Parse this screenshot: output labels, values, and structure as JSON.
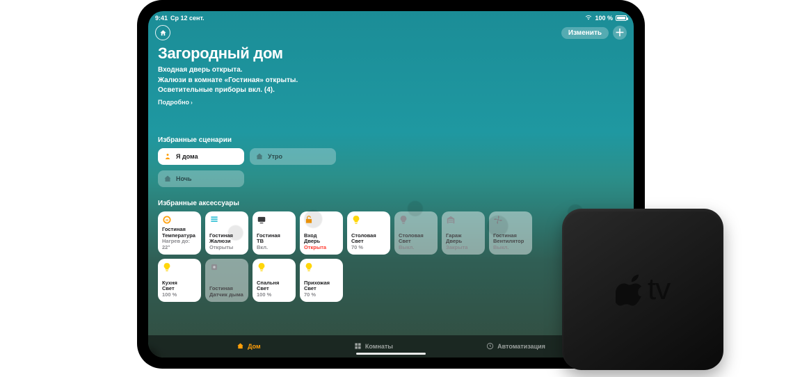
{
  "statusbar": {
    "time": "9:41",
    "date": "Ср 12 сент.",
    "battery_pct": "100 %"
  },
  "nav": {
    "edit_label": "Изменить"
  },
  "header": {
    "title": "Загородный дом",
    "lines": [
      "Входная дверь открыта.",
      "Жалюзи в комнате «Гостиная» открыты.",
      "Осветительные приборы вкл. (4)."
    ],
    "details_label": "Подробно"
  },
  "scenes": {
    "section_label": "Избранные сценарии",
    "items": [
      {
        "label": "Я дома",
        "active": true,
        "icon": "person"
      },
      {
        "label": "Утро",
        "active": false,
        "icon": "house"
      },
      {
        "label": "Ночь",
        "active": false,
        "icon": "house"
      }
    ]
  },
  "accessories": {
    "section_label": "Избранные аксессуары",
    "items": [
      {
        "room": "Гостиная",
        "name": "Температура",
        "state": "Нагрев до: 22°",
        "icon": "thermostat",
        "on": true,
        "alert": false,
        "icon_color": "#ff9f0a"
      },
      {
        "room": "Гостиная",
        "name": "Жалюзи",
        "state": "Открыты",
        "icon": "blinds",
        "on": true,
        "alert": false,
        "icon_color": "#34c1d6"
      },
      {
        "room": "Гостиная",
        "name": "ТВ",
        "state": "Вкл.",
        "icon": "tv",
        "on": true,
        "alert": false,
        "icon_color": "#3a3a3c"
      },
      {
        "room": "Вход",
        "name": "Дверь",
        "state": "Открыта",
        "icon": "lock",
        "on": true,
        "alert": true,
        "icon_color": "#ff9f0a"
      },
      {
        "room": "Столовая",
        "name": "Свет",
        "state": "70 %",
        "icon": "bulb",
        "on": true,
        "alert": false,
        "icon_color": "#ffd60a"
      },
      {
        "room": "Столовая",
        "name": "Свет",
        "state": "Выкл.",
        "icon": "bulb",
        "on": false,
        "alert": false,
        "icon_color": "#8e8e93"
      },
      {
        "room": "Гараж",
        "name": "Дверь",
        "state": "Закрыта",
        "icon": "garage",
        "on": false,
        "alert": false,
        "icon_color": "#8e8e93"
      },
      {
        "room": "Гостиная",
        "name": "Вентилятор",
        "state": "Выкл.",
        "icon": "fan",
        "on": false,
        "alert": false,
        "icon_color": "#8e8e93"
      },
      {
        "room": "Кухня",
        "name": "Свет",
        "state": "100 %",
        "icon": "bulb",
        "on": true,
        "alert": false,
        "icon_color": "#ffd60a"
      },
      {
        "room": "Гостиная",
        "name": "Датчик дыма",
        "state": "",
        "icon": "sensor",
        "on": false,
        "alert": false,
        "icon_color": "#8e8e93"
      },
      {
        "room": "Спальня",
        "name": "Свет",
        "state": "100 %",
        "icon": "bulb",
        "on": true,
        "alert": false,
        "icon_color": "#ffd60a"
      },
      {
        "room": "Прихожая",
        "name": "Свет",
        "state": "70 %",
        "icon": "bulb",
        "on": true,
        "alert": false,
        "icon_color": "#ffd60a"
      }
    ]
  },
  "tabs": {
    "items": [
      {
        "label": "Дом",
        "icon": "house",
        "active": true
      },
      {
        "label": "Комнаты",
        "icon": "grid",
        "active": false
      },
      {
        "label": "Автоматизация",
        "icon": "clock",
        "active": false
      }
    ]
  },
  "appletv_label": "tv"
}
